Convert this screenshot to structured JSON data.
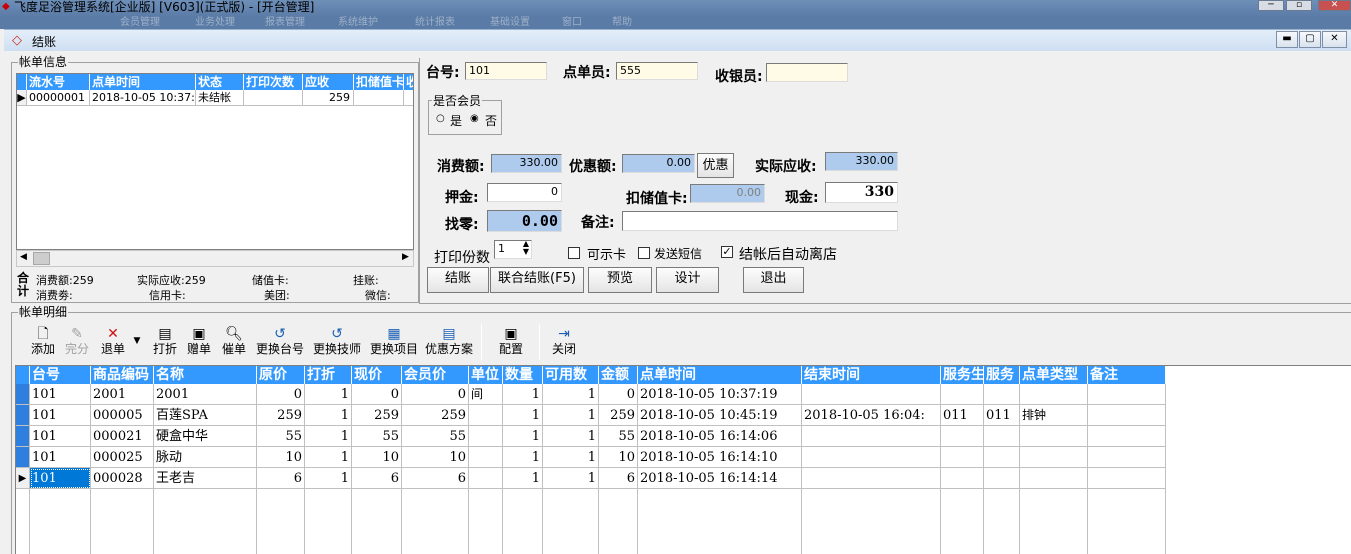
{
  "window": {
    "app_title": "飞度足浴管理系统[企业版] [V603](正式版) - [开台管理]",
    "dialog_title": "结账",
    "menu_items": [
      "会员管理",
      "业务处理",
      "报表管理",
      "系统维护",
      "统计报表",
      "基础设置",
      "窗口",
      "帮助"
    ]
  },
  "bill_info": {
    "group_label": "帐单信息",
    "columns": [
      "流水号",
      "点单时间",
      "状态",
      "打印次数",
      "应收",
      "扣储值卡",
      "收"
    ],
    "rows": [
      {
        "serial": "00000001",
        "order_time": "2018-10-05 10:37:",
        "status": "未结帐",
        "print_count": "",
        "receivable": "259",
        "stored_card": "",
        "extra": ""
      }
    ],
    "summary_label": "合计",
    "summary": {
      "consume": "消费额:259",
      "actual": "实际应收:259",
      "stored_card": "储值卡:",
      "on_account": "挂账:",
      "coupon": "消费劵:",
      "credit_card": "信用卡:",
      "meituan": "美团:",
      "wechat": "微信:"
    }
  },
  "checkout": {
    "table_no_label": "台号:",
    "table_no": "101",
    "waiter_label": "点单员:",
    "waiter": "555",
    "cashier_label": "收银员:",
    "cashier": "",
    "member_group_label": "是否会员",
    "member_yes": "是",
    "member_no": "否",
    "consume_label": "消费额:",
    "consume": "330.00",
    "discount_label": "优惠额:",
    "discount": "0.00",
    "discount_button": "优惠",
    "actual_label": "实际应收:",
    "actual": "330.00",
    "deposit_label": "押金:",
    "deposit": "0",
    "stored_card_label": "扣储值卡:",
    "stored_card": "0.00",
    "cash_label": "现金:",
    "cash": "330",
    "change_label": "找零:",
    "change": "0.00",
    "remark_label": "备注:",
    "remark": "",
    "print_copies_label": "打印份数",
    "print_copies": "1",
    "option_card": "可示卡",
    "option_sms": "发送短信",
    "option_auto_leave": "结帐后自动离店",
    "buttons": {
      "checkout": "结账",
      "joint_checkout": "联合结账(F5)",
      "preview": "预览",
      "design": "设计",
      "exit": "退出"
    }
  },
  "toolbar": {
    "group_label": "帐单明细",
    "items": {
      "add": "添加",
      "finish": "完分",
      "return_order": "退单",
      "discount": "打折",
      "gift": "赠单",
      "urge": "催单",
      "change_table": "更换台号",
      "change_tech": "更换技师",
      "change_item": "更换项目",
      "promo": "优惠方案",
      "config": "配置",
      "close": "关闭"
    }
  },
  "detail": {
    "columns": [
      "台号",
      "商品编码",
      "名称",
      "原价",
      "打折",
      "现价",
      "会员价",
      "单位",
      "数量",
      "可用数",
      "金额",
      "点单时间",
      "结束时间",
      "服务生",
      "服务",
      "点单类型",
      "备注"
    ],
    "rows": [
      {
        "table": "101",
        "code": "2001",
        "name": "2001",
        "orig_price": "0",
        "discount": "1",
        "price": "0",
        "member_price": "0",
        "unit": "间",
        "qty": "1",
        "avail": "1",
        "amount": "0",
        "order_time": "2018-10-05 10:37:19",
        "end_time": "",
        "waiter": "",
        "service": "",
        "order_type": "",
        "remark": ""
      },
      {
        "table": "101",
        "code": "000005",
        "name": "百莲SPA",
        "orig_price": "259",
        "discount": "1",
        "price": "259",
        "member_price": "259",
        "unit": "",
        "qty": "1",
        "avail": "1",
        "amount": "259",
        "order_time": "2018-10-05 10:45:19",
        "end_time": "2018-10-05 16:04:",
        "waiter": "011",
        "service": "011",
        "order_type": "排钟",
        "remark": ""
      },
      {
        "table": "101",
        "code": "000021",
        "name": "硬盒中华",
        "orig_price": "55",
        "discount": "1",
        "price": "55",
        "member_price": "55",
        "unit": "",
        "qty": "1",
        "avail": "1",
        "amount": "55",
        "order_time": "2018-10-05 16:14:06",
        "end_time": "",
        "waiter": "",
        "service": "",
        "order_type": "",
        "remark": ""
      },
      {
        "table": "101",
        "code": "000025",
        "name": "脉动",
        "orig_price": "10",
        "discount": "1",
        "price": "10",
        "member_price": "10",
        "unit": "",
        "qty": "1",
        "avail": "1",
        "amount": "10",
        "order_time": "2018-10-05 16:14:10",
        "end_time": "",
        "waiter": "",
        "service": "",
        "order_type": "",
        "remark": ""
      },
      {
        "table": "101",
        "code": "000028",
        "name": "王老吉",
        "orig_price": "6",
        "discount": "1",
        "price": "6",
        "member_price": "6",
        "unit": "",
        "qty": "1",
        "avail": "1",
        "amount": "6",
        "order_time": "2018-10-05 16:14:14",
        "end_time": "",
        "waiter": "",
        "service": "",
        "order_type": "",
        "remark": ""
      }
    ]
  },
  "colors": {
    "grid_header": "#3399ff",
    "selected_cell": "#0078d7",
    "amount_field": "#aecbed"
  }
}
